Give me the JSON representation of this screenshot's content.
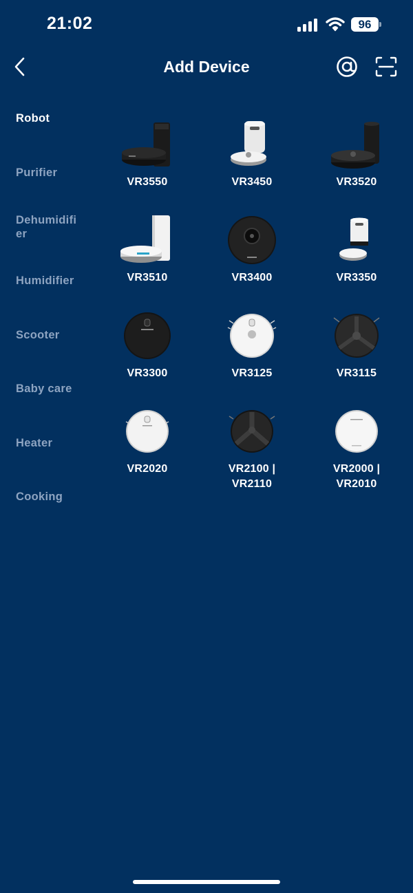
{
  "status_bar": {
    "time": "21:02",
    "battery": "96"
  },
  "header": {
    "title": "Add Device"
  },
  "categories": [
    {
      "label": "Robot",
      "active": true
    },
    {
      "label": "Purifier"
    },
    {
      "label": "Dehumidifier"
    },
    {
      "label": "Humidifier"
    },
    {
      "label": "Scooter"
    },
    {
      "label": "Baby care"
    },
    {
      "label": "Heater"
    },
    {
      "label": "Cooking"
    }
  ],
  "devices": [
    {
      "label": "VR3550",
      "image": "robot-black-tall-dock"
    },
    {
      "label": "VR3450",
      "image": "robot-white-dock"
    },
    {
      "label": "VR3520",
      "image": "robot-black-tall-dock"
    },
    {
      "label": "VR3510",
      "image": "robot-white-tall-dock"
    },
    {
      "label": "VR3400",
      "image": "robot-black-top"
    },
    {
      "label": "VR3350",
      "image": "robot-white-small-dock"
    },
    {
      "label": "VR3300",
      "image": "robot-black-top"
    },
    {
      "label": "VR3125",
      "image": "robot-white-top"
    },
    {
      "label": "VR3115",
      "image": "robot-black-y-top"
    },
    {
      "label": "VR2020",
      "image": "robot-white-top"
    },
    {
      "label": "VR2100 | VR2110",
      "image": "robot-black-y-top"
    },
    {
      "label": "VR2000 | VR2010",
      "image": "robot-white-top"
    }
  ],
  "colors": {
    "background": "#02305f",
    "inactive_text": "#8ea4c1",
    "text": "#ffffff"
  }
}
